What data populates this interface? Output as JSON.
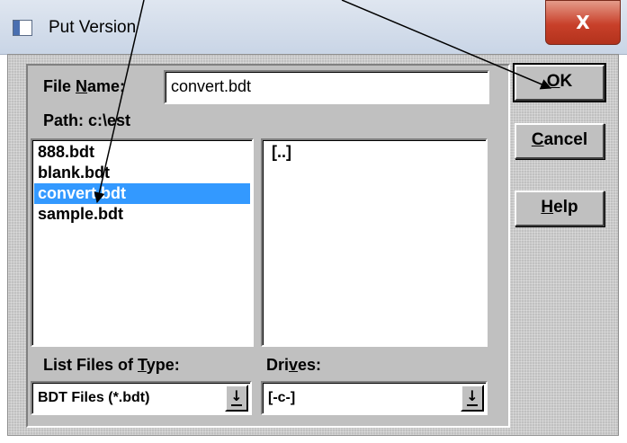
{
  "window": {
    "title": "Put Version",
    "close_label": "X"
  },
  "dialog": {
    "filename_label_pre": "File ",
    "filename_label_key": "N",
    "filename_label_post": "ame:",
    "filename_value": "convert.bdt",
    "path_label": "Path: c:\\est",
    "files": [
      "888.bdt",
      "blank.bdt",
      "convert.bdt",
      "sample.bdt"
    ],
    "selected_file": "convert.bdt",
    "directories": [
      "[..]"
    ],
    "type_label_pre": "List Files of ",
    "type_label_key": "T",
    "type_label_post": "ype:",
    "type_value": "BDT Files (*.bdt)",
    "drives_label_pre": "Dri",
    "drives_label_key": "v",
    "drives_label_post": "es:",
    "drive_value": "[-c-]",
    "dropdown_glyph": "↓"
  },
  "buttons": {
    "ok_key": "O",
    "ok_rest": "K",
    "cancel_key": "C",
    "cancel_rest": "ancel",
    "help_key": "H",
    "help_rest": "elp"
  },
  "colors": {
    "selection": "#3399ff",
    "close_button": "#c8402a",
    "dialog_face": "#c0c0c0"
  }
}
